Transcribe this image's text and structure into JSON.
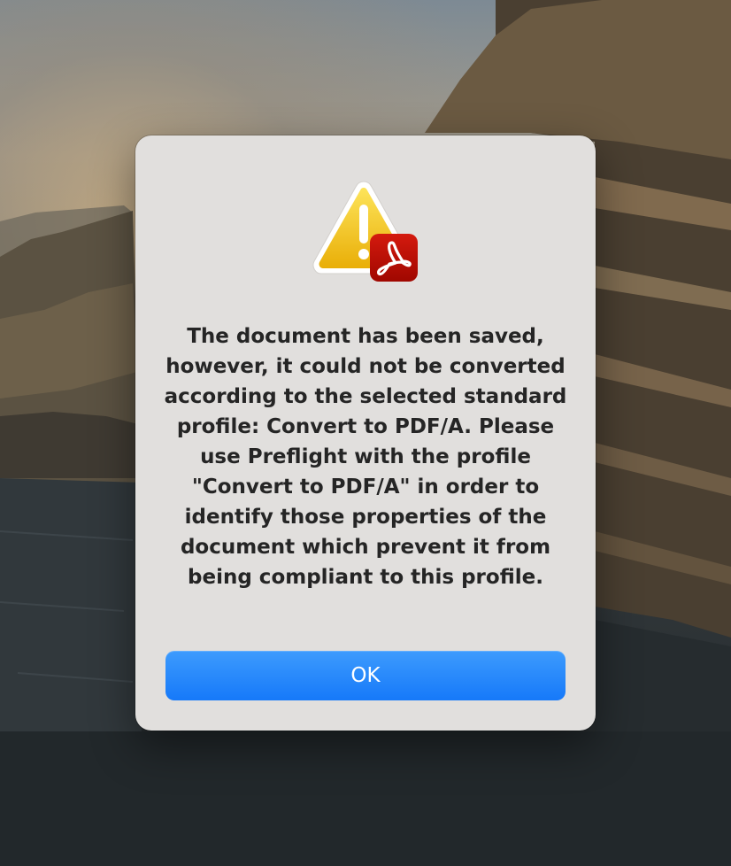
{
  "alert": {
    "icon": "warning-triangle-with-acrobat-badge",
    "message": "The document has been saved, however, it could not be converted according to the selected standard profile: Convert to PDF/A. Please use Preflight with the profile \"Convert to PDF/A\" in order to identify those properties of the document which prevent it from being compliant to this profile.",
    "ok_label": "OK"
  },
  "colors": {
    "dialog_background": "#e1dfdd",
    "button_accent": "#1a7ffa",
    "warning_yellow": "#f6c41a",
    "acrobat_red": "#b30b00"
  }
}
